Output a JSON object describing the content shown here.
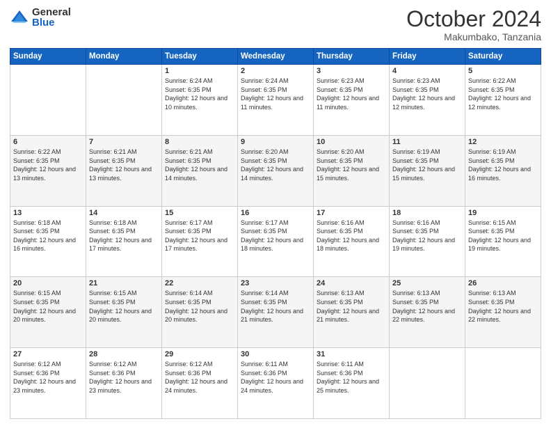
{
  "logo": {
    "general": "General",
    "blue": "Blue"
  },
  "header": {
    "month": "October 2024",
    "location": "Makumbako, Tanzania"
  },
  "days_of_week": [
    "Sunday",
    "Monday",
    "Tuesday",
    "Wednesday",
    "Thursday",
    "Friday",
    "Saturday"
  ],
  "weeks": [
    [
      {
        "day": "",
        "sunrise": "",
        "sunset": "",
        "daylight": ""
      },
      {
        "day": "",
        "sunrise": "",
        "sunset": "",
        "daylight": ""
      },
      {
        "day": "1",
        "sunrise": "Sunrise: 6:24 AM",
        "sunset": "Sunset: 6:35 PM",
        "daylight": "Daylight: 12 hours and 10 minutes."
      },
      {
        "day": "2",
        "sunrise": "Sunrise: 6:24 AM",
        "sunset": "Sunset: 6:35 PM",
        "daylight": "Daylight: 12 hours and 11 minutes."
      },
      {
        "day": "3",
        "sunrise": "Sunrise: 6:23 AM",
        "sunset": "Sunset: 6:35 PM",
        "daylight": "Daylight: 12 hours and 11 minutes."
      },
      {
        "day": "4",
        "sunrise": "Sunrise: 6:23 AM",
        "sunset": "Sunset: 6:35 PM",
        "daylight": "Daylight: 12 hours and 12 minutes."
      },
      {
        "day": "5",
        "sunrise": "Sunrise: 6:22 AM",
        "sunset": "Sunset: 6:35 PM",
        "daylight": "Daylight: 12 hours and 12 minutes."
      }
    ],
    [
      {
        "day": "6",
        "sunrise": "Sunrise: 6:22 AM",
        "sunset": "Sunset: 6:35 PM",
        "daylight": "Daylight: 12 hours and 13 minutes."
      },
      {
        "day": "7",
        "sunrise": "Sunrise: 6:21 AM",
        "sunset": "Sunset: 6:35 PM",
        "daylight": "Daylight: 12 hours and 13 minutes."
      },
      {
        "day": "8",
        "sunrise": "Sunrise: 6:21 AM",
        "sunset": "Sunset: 6:35 PM",
        "daylight": "Daylight: 12 hours and 14 minutes."
      },
      {
        "day": "9",
        "sunrise": "Sunrise: 6:20 AM",
        "sunset": "Sunset: 6:35 PM",
        "daylight": "Daylight: 12 hours and 14 minutes."
      },
      {
        "day": "10",
        "sunrise": "Sunrise: 6:20 AM",
        "sunset": "Sunset: 6:35 PM",
        "daylight": "Daylight: 12 hours and 15 minutes."
      },
      {
        "day": "11",
        "sunrise": "Sunrise: 6:19 AM",
        "sunset": "Sunset: 6:35 PM",
        "daylight": "Daylight: 12 hours and 15 minutes."
      },
      {
        "day": "12",
        "sunrise": "Sunrise: 6:19 AM",
        "sunset": "Sunset: 6:35 PM",
        "daylight": "Daylight: 12 hours and 16 minutes."
      }
    ],
    [
      {
        "day": "13",
        "sunrise": "Sunrise: 6:18 AM",
        "sunset": "Sunset: 6:35 PM",
        "daylight": "Daylight: 12 hours and 16 minutes."
      },
      {
        "day": "14",
        "sunrise": "Sunrise: 6:18 AM",
        "sunset": "Sunset: 6:35 PM",
        "daylight": "Daylight: 12 hours and 17 minutes."
      },
      {
        "day": "15",
        "sunrise": "Sunrise: 6:17 AM",
        "sunset": "Sunset: 6:35 PM",
        "daylight": "Daylight: 12 hours and 17 minutes."
      },
      {
        "day": "16",
        "sunrise": "Sunrise: 6:17 AM",
        "sunset": "Sunset: 6:35 PM",
        "daylight": "Daylight: 12 hours and 18 minutes."
      },
      {
        "day": "17",
        "sunrise": "Sunrise: 6:16 AM",
        "sunset": "Sunset: 6:35 PM",
        "daylight": "Daylight: 12 hours and 18 minutes."
      },
      {
        "day": "18",
        "sunrise": "Sunrise: 6:16 AM",
        "sunset": "Sunset: 6:35 PM",
        "daylight": "Daylight: 12 hours and 19 minutes."
      },
      {
        "day": "19",
        "sunrise": "Sunrise: 6:15 AM",
        "sunset": "Sunset: 6:35 PM",
        "daylight": "Daylight: 12 hours and 19 minutes."
      }
    ],
    [
      {
        "day": "20",
        "sunrise": "Sunrise: 6:15 AM",
        "sunset": "Sunset: 6:35 PM",
        "daylight": "Daylight: 12 hours and 20 minutes."
      },
      {
        "day": "21",
        "sunrise": "Sunrise: 6:15 AM",
        "sunset": "Sunset: 6:35 PM",
        "daylight": "Daylight: 12 hours and 20 minutes."
      },
      {
        "day": "22",
        "sunrise": "Sunrise: 6:14 AM",
        "sunset": "Sunset: 6:35 PM",
        "daylight": "Daylight: 12 hours and 20 minutes."
      },
      {
        "day": "23",
        "sunrise": "Sunrise: 6:14 AM",
        "sunset": "Sunset: 6:35 PM",
        "daylight": "Daylight: 12 hours and 21 minutes."
      },
      {
        "day": "24",
        "sunrise": "Sunrise: 6:13 AM",
        "sunset": "Sunset: 6:35 PM",
        "daylight": "Daylight: 12 hours and 21 minutes."
      },
      {
        "day": "25",
        "sunrise": "Sunrise: 6:13 AM",
        "sunset": "Sunset: 6:35 PM",
        "daylight": "Daylight: 12 hours and 22 minutes."
      },
      {
        "day": "26",
        "sunrise": "Sunrise: 6:13 AM",
        "sunset": "Sunset: 6:35 PM",
        "daylight": "Daylight: 12 hours and 22 minutes."
      }
    ],
    [
      {
        "day": "27",
        "sunrise": "Sunrise: 6:12 AM",
        "sunset": "Sunset: 6:36 PM",
        "daylight": "Daylight: 12 hours and 23 minutes."
      },
      {
        "day": "28",
        "sunrise": "Sunrise: 6:12 AM",
        "sunset": "Sunset: 6:36 PM",
        "daylight": "Daylight: 12 hours and 23 minutes."
      },
      {
        "day": "29",
        "sunrise": "Sunrise: 6:12 AM",
        "sunset": "Sunset: 6:36 PM",
        "daylight": "Daylight: 12 hours and 24 minutes."
      },
      {
        "day": "30",
        "sunrise": "Sunrise: 6:11 AM",
        "sunset": "Sunset: 6:36 PM",
        "daylight": "Daylight: 12 hours and 24 minutes."
      },
      {
        "day": "31",
        "sunrise": "Sunrise: 6:11 AM",
        "sunset": "Sunset: 6:36 PM",
        "daylight": "Daylight: 12 hours and 25 minutes."
      },
      {
        "day": "",
        "sunrise": "",
        "sunset": "",
        "daylight": ""
      },
      {
        "day": "",
        "sunrise": "",
        "sunset": "",
        "daylight": ""
      }
    ]
  ]
}
